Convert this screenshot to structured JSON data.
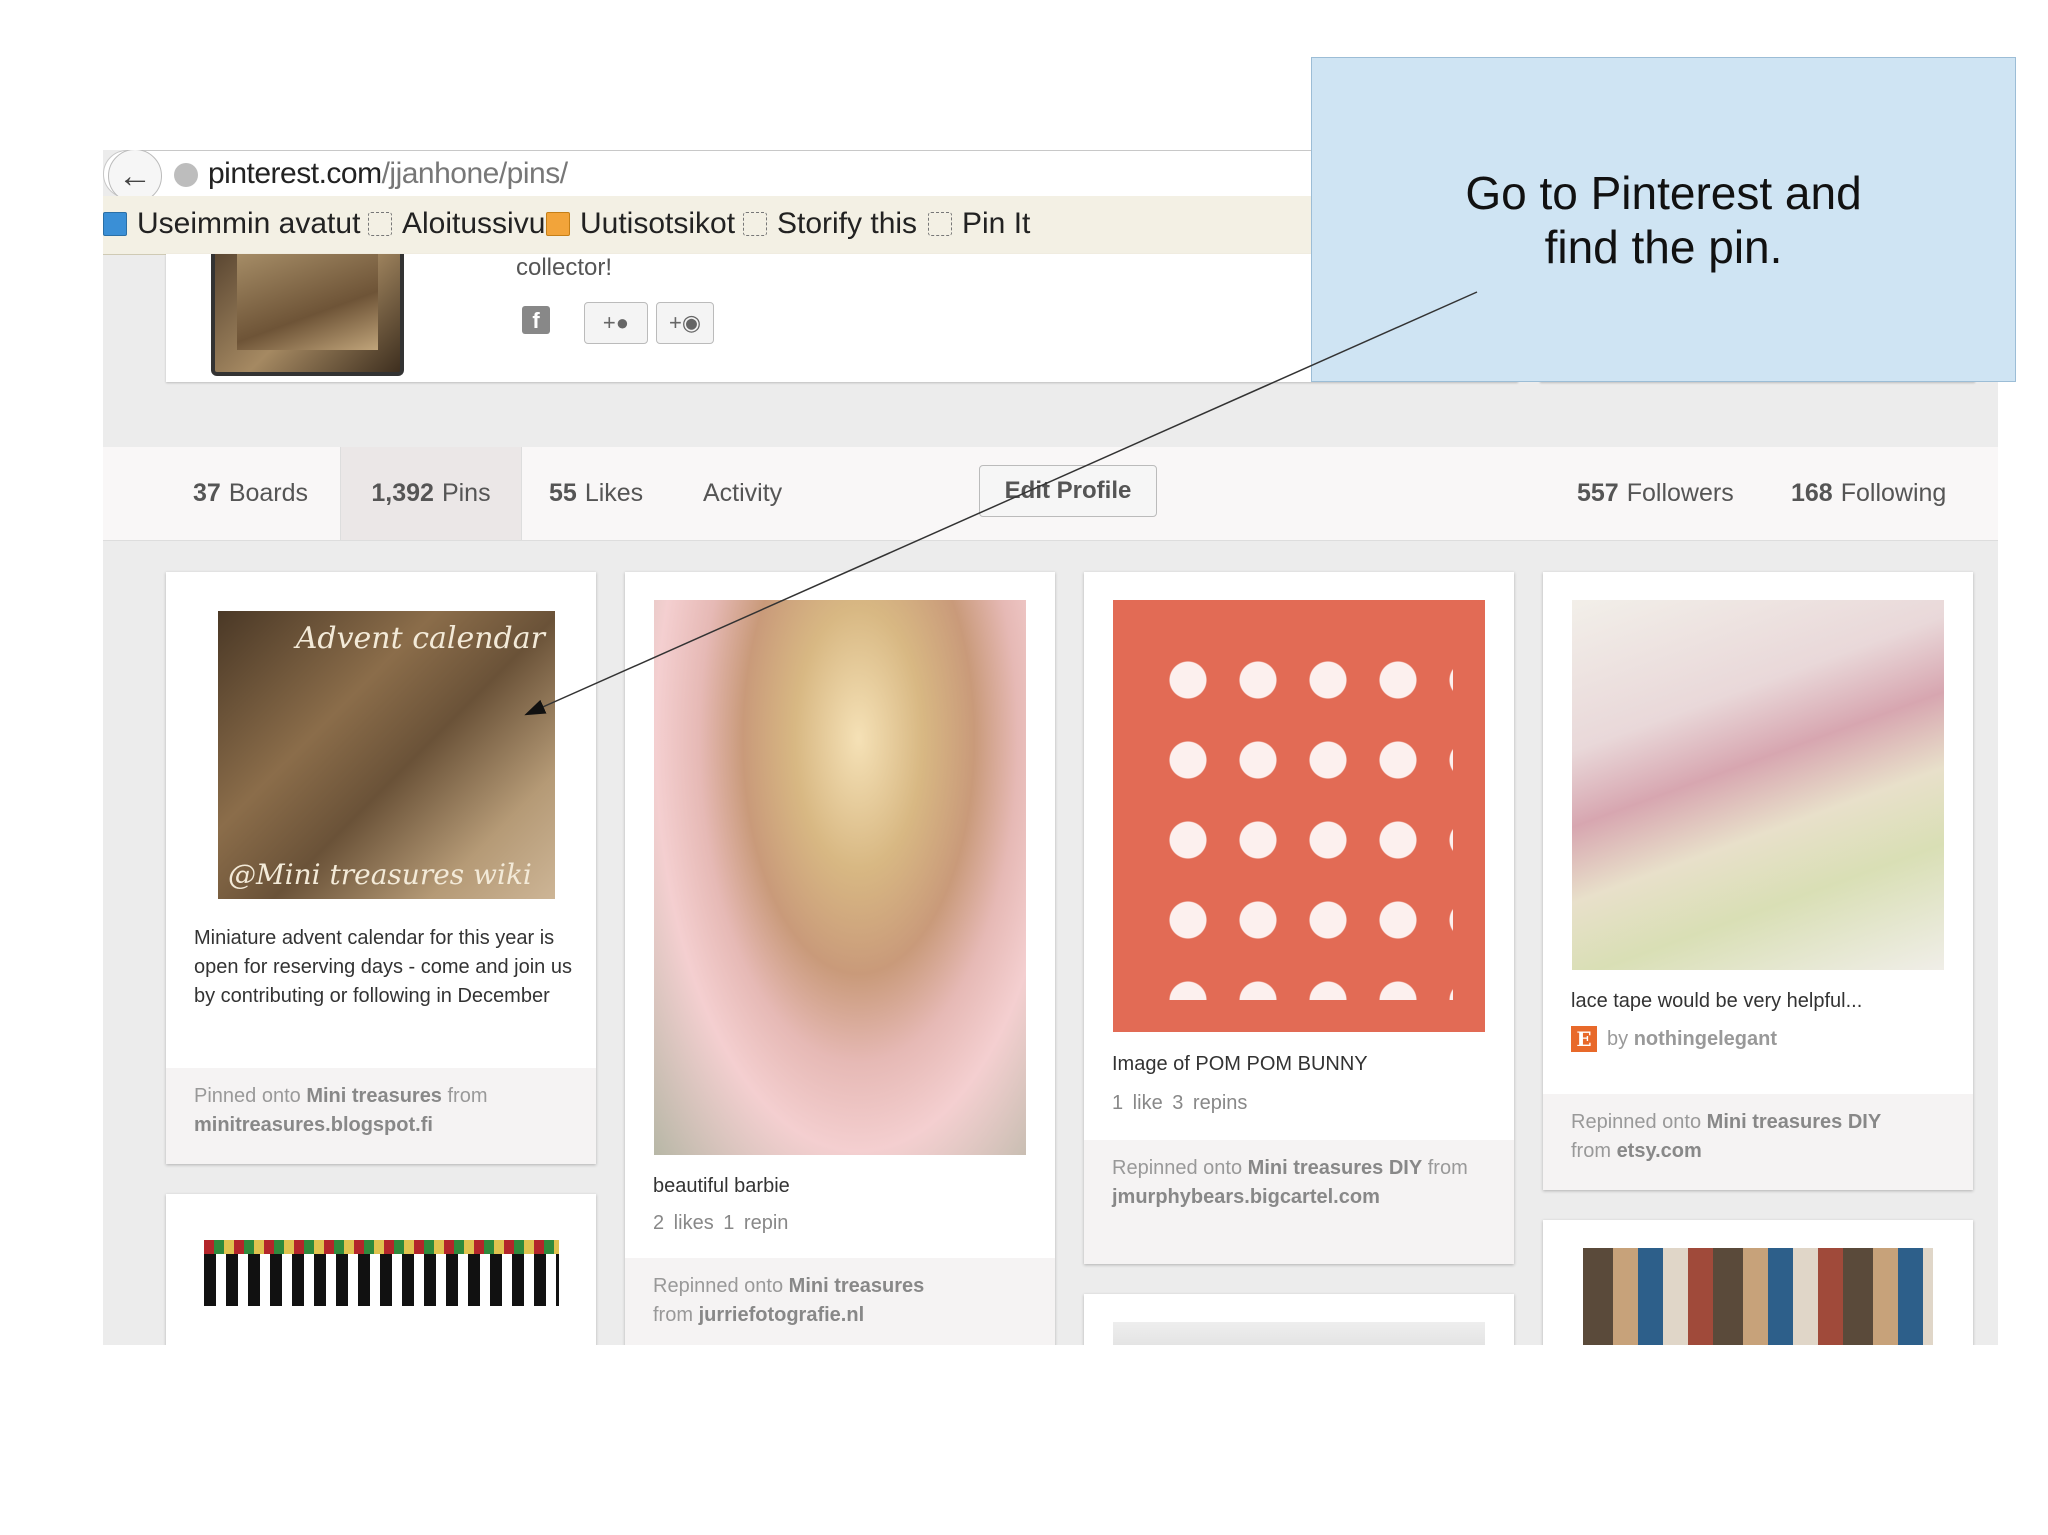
{
  "browser": {
    "url_host": "pinterest.com",
    "url_path": "/jjanhone/pins/",
    "bookmarks": [
      "Useimmin avatut",
      "Aloitussivu",
      "Uutisotsikot",
      "Storify this",
      "Pin It"
    ]
  },
  "profile": {
    "about_text": "collector!",
    "social_buttons": [
      "+",
      "+"
    ]
  },
  "tabs": {
    "boards_count": "37",
    "boards_label": "Boards",
    "pins_count": "1,392",
    "pins_label": "Pins",
    "likes_count": "55",
    "likes_label": "Likes",
    "activity_label": "Activity",
    "edit_profile": "Edit Profile",
    "followers_count": "557",
    "followers_label": "Followers",
    "following_count": "168",
    "following_label": "Following"
  },
  "pins": [
    {
      "image_text_top": "Advent calendar",
      "image_text_bottom": "@Mini treasures wiki",
      "description": "Miniature advent calendar for this year is open for reserving days - come and join us by contributing or following in December",
      "pinned_prefix": "Pinned onto",
      "board": "Mini treasures",
      "from_label": "from",
      "source": "minitreasures.blogspot.fi"
    },
    {
      "description": "beautiful barbie",
      "stats": "2 likes   1 repin",
      "pinned_prefix": "Repinned onto",
      "board": "Mini treasures",
      "from_label": "from",
      "source": "jurriefotografie.nl"
    },
    {
      "description": "Image of POM POM BUNNY",
      "stats": "1 like   3 repins",
      "pinned_prefix": "Repinned onto",
      "board": "Mini treasures DIY",
      "from_label": "from",
      "source": "jmurphybears.bigcartel.com"
    },
    {
      "description": "lace tape would be very helpful...",
      "by_label": "by",
      "by_user": "nothingelegant",
      "pinned_prefix": "Repinned onto",
      "board": "Mini treasures DIY",
      "from_label": "from",
      "source": "etsy.com"
    }
  ],
  "callout": {
    "line1": "Go to Pinterest and",
    "line2": "find the pin."
  },
  "colors": {
    "callout_bg": "#cfe4f3",
    "pinterest_bg": "#ececec",
    "bookmark_bar": "#f3f0e4",
    "etsy_orange": "#e8692a"
  }
}
